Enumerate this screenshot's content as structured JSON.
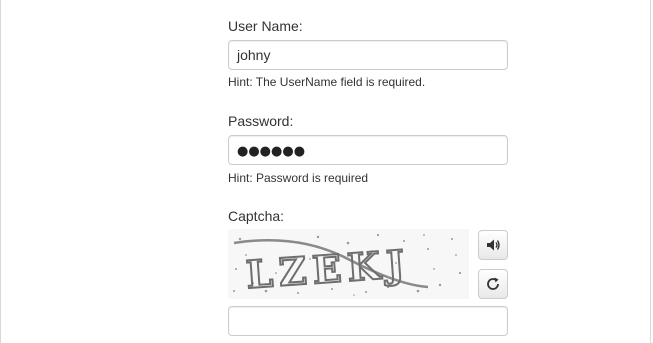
{
  "form": {
    "username": {
      "label": "User Name:",
      "value": "johny",
      "hint": "Hint: The UserName field is required."
    },
    "password": {
      "label": "Password:",
      "masked_value": "●●●●●●",
      "hint": "Hint: Password is required"
    },
    "captcha": {
      "label": "Captcha:",
      "image_text": "LZEKJ",
      "audio_icon": "speaker-icon",
      "refresh_icon": "refresh-icon",
      "input_value": ""
    }
  }
}
